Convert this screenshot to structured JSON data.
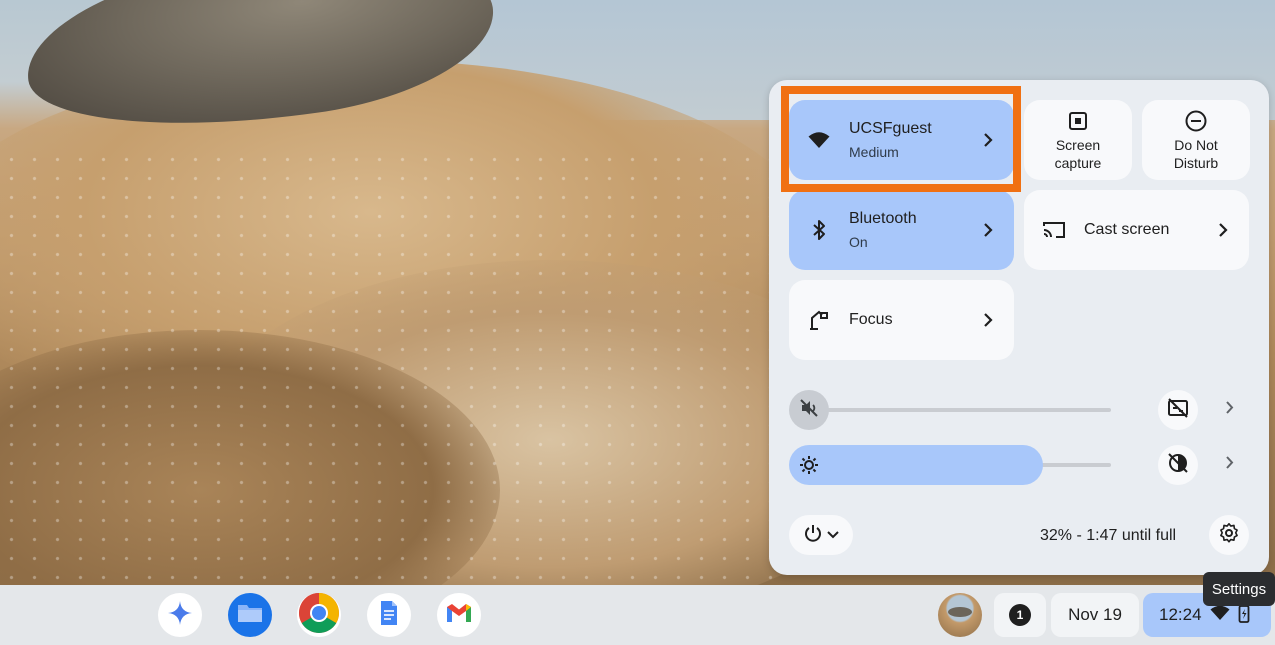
{
  "quick_settings": {
    "network_tile": {
      "title": "UCSFguest",
      "subtitle": "Medium",
      "icon": "wifi-icon"
    },
    "screen_capture": {
      "label_line1": "Screen",
      "label_line2": "capture",
      "icon": "screen-capture-icon"
    },
    "dnd": {
      "label_line1": "Do Not",
      "label_line2": "Disturb",
      "icon": "do-not-disturb-icon"
    },
    "bluetooth_tile": {
      "title": "Bluetooth",
      "subtitle": "On",
      "icon": "bluetooth-icon"
    },
    "cast_tile": {
      "title": "Cast screen",
      "icon": "cast-icon"
    },
    "focus_tile": {
      "title": "Focus",
      "icon": "focus-lamp-icon"
    },
    "volume": {
      "muted": true,
      "level": 0,
      "icon": "volume-muted-icon"
    },
    "brightness": {
      "level": 0.76,
      "icon": "brightness-icon"
    },
    "battery_text": "32% - 1:47 until full"
  },
  "shelf": {
    "apps": [
      "gemini-icon",
      "files-icon",
      "chrome-icon",
      "docs-icon",
      "gmail-icon"
    ],
    "notification_count": "1",
    "date": "Nov 19",
    "time": "12:24"
  },
  "tooltip": "Settings",
  "colors": {
    "accent": "#a8c7fa",
    "highlight": "#f07012",
    "panel": "#e9edf2"
  }
}
